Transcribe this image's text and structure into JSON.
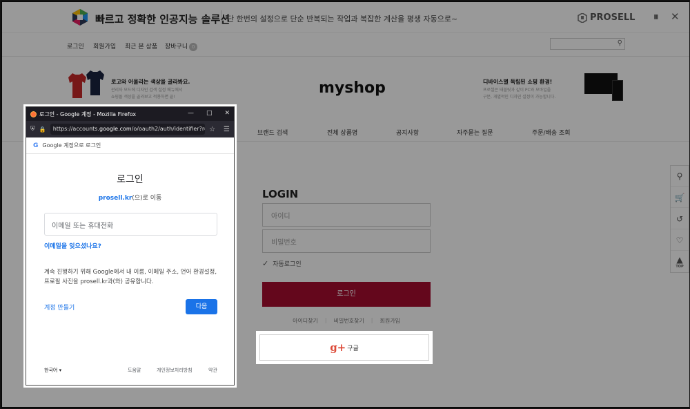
{
  "promo": {
    "title": "빠르고 정확한 인공지능 솔루션",
    "description": "단 한번의 설정으로 단순 반복되는 작업과 복잡한 계산을 평생 자동으로~",
    "brand": "PROSELL"
  },
  "window_controls": {
    "pause": "⏸",
    "close": "✕"
  },
  "nav": {
    "login": "로그인",
    "join": "회원가입",
    "recent": "최근 본 상품",
    "cart": "장바구니",
    "cart_count": "0"
  },
  "header": {
    "site_name": "myshop",
    "banner_left_title": "로고와 어울리는 색상을 골라봐요.",
    "banner_left_desc1": "관리자 모드에 디자인 검색 설정 메뉴에서",
    "banner_left_desc2": "쇼핑몰 색상을 골라보고 적용하면 끝!",
    "banner_right_title": "디바이스별 독립된 쇼핑 환경!",
    "banner_right_desc1": "프로셀은 태블릿과 같이 PC와 모바일을",
    "banner_right_desc2": "구분, 개별적인 디자인 설정이 가능합니다."
  },
  "menu": {
    "brand_search": "브랜드 검색",
    "all_products": "전체 상품명",
    "notice": "공지사항",
    "faq": "자주묻는 질문",
    "order_lookup": "주문/배송 조회"
  },
  "login_form": {
    "title": "LOGIN",
    "id_placeholder": "아이디",
    "pw_placeholder": "비밀번호",
    "keep_login": "자동로그인",
    "submit": "로그인",
    "find_id": "아이디찾기",
    "find_pw": "비밀번호찾기",
    "join": "회원가입",
    "google_plus": "g+",
    "google_label": "구글"
  },
  "quickbar": {
    "top_label": "TOP"
  },
  "popup": {
    "window_title": "로그인 - Google 계정 - Mozilla Firefox",
    "url_prefix": "https://accounts.",
    "url_host": "google.com",
    "url_rest": "/o/oauth2/auth/identifier?rec",
    "google_header": "Google 계정으로 로그인",
    "heading": "로그인",
    "redirect_host": "prosell.kr",
    "redirect_suffix": "(으)로 이동",
    "email_placeholder": "이메일 또는 휴대전화",
    "forgot_email": "이메일을 잊으셨나요?",
    "info": "계속 진행하기 위해 Google에서 내 이름, 이메일 주소, 언어 환경설정, 프로필 사진을 prosell.kr과(와) 공유합니다.",
    "create_account": "계정 만들기",
    "next": "다음",
    "language": "한국어",
    "help": "도움말",
    "privacy": "개인정보처리방침",
    "terms": "약관"
  },
  "colors": {
    "login_button": "#a70d2f",
    "google_blue": "#1a73e8",
    "google_plus_red": "#dd4b39"
  }
}
